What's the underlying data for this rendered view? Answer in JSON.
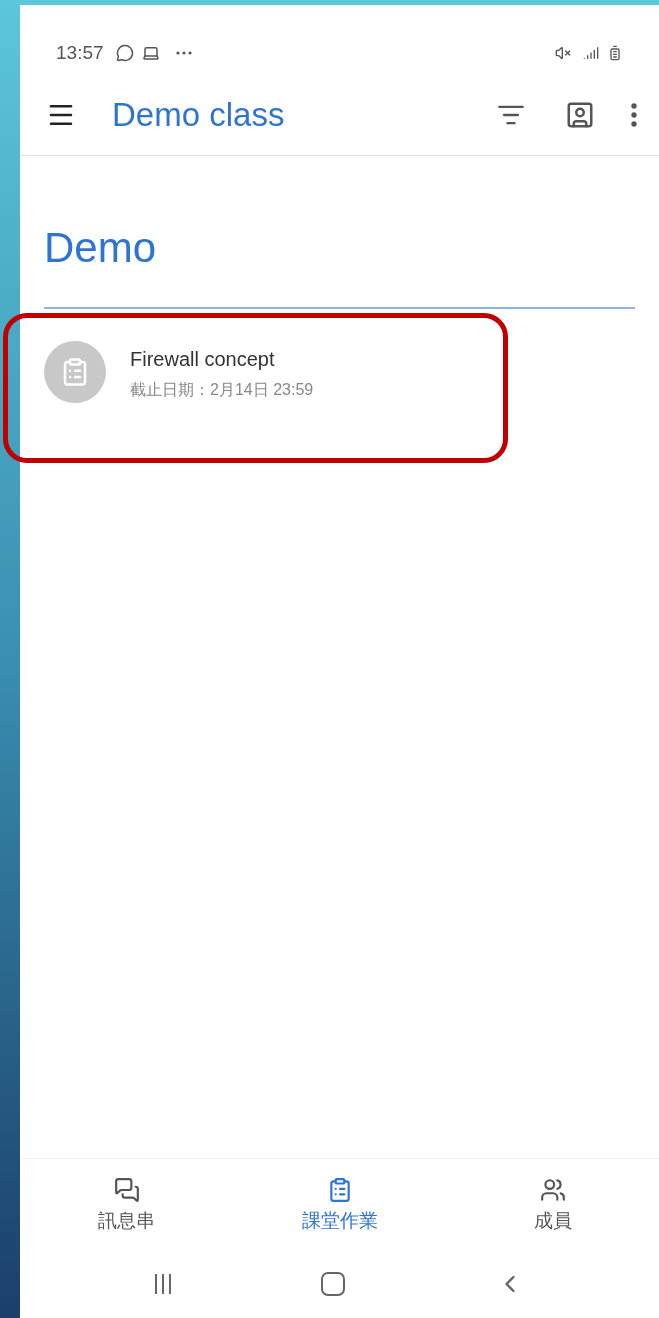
{
  "status_bar": {
    "time": "13:57"
  },
  "app_bar": {
    "title": "Demo class"
  },
  "topic": {
    "title": "Demo"
  },
  "assignments": [
    {
      "title": "Firewall concept",
      "due": "截止日期：2月14日 23:59",
      "highlighted": true
    }
  ],
  "bottom_nav": [
    {
      "label": "訊息串",
      "kind": "stream",
      "selected": false
    },
    {
      "label": "課堂作業",
      "kind": "classwork",
      "selected": true
    },
    {
      "label": "成員",
      "kind": "people",
      "selected": false
    }
  ]
}
